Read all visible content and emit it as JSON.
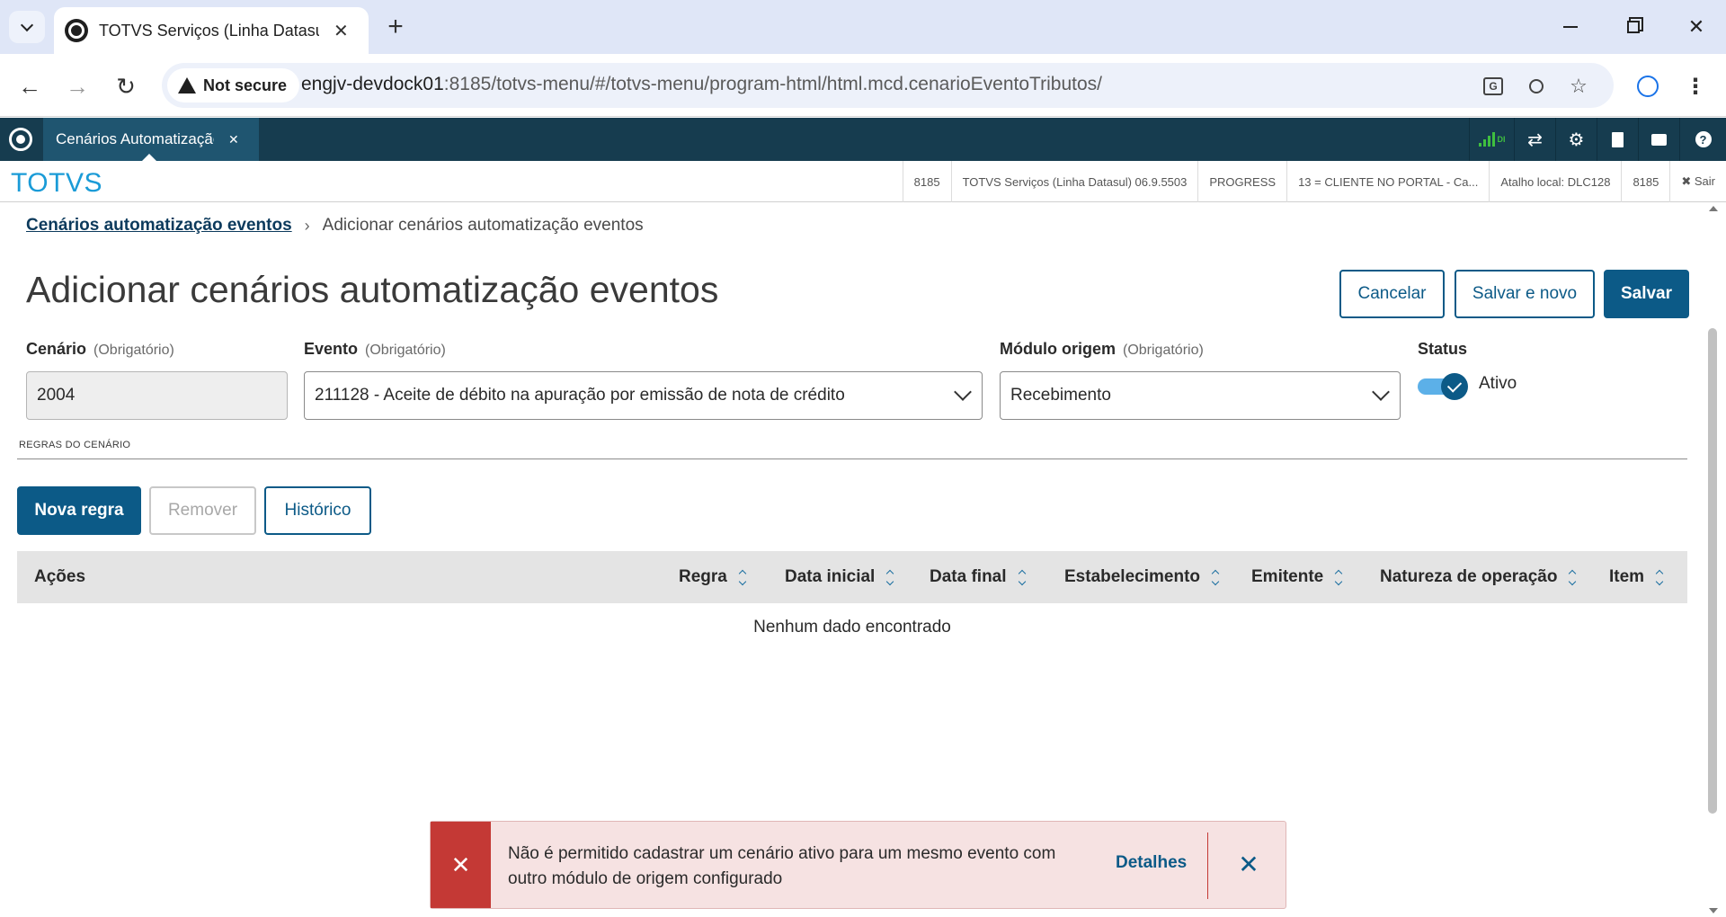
{
  "browser": {
    "tab_title": "TOTVS Serviços (Linha Datasul)",
    "url_host": "engjv-devdock01",
    "url_rest": ":8185/totvs-menu/#/totvs-menu/program-html/html.mcd.cenarioEventoTributos/",
    "security_label": "Not secure",
    "icons": {
      "tab_menu": "chevron-down-icon",
      "close": "close-icon",
      "new_tab": "plus-icon",
      "back": "back-arrow-icon",
      "forward": "forward-arrow-icon",
      "reload": "reload-icon",
      "translate": "translate-icon",
      "zoom": "zoom-out-icon",
      "bookmark": "star-icon",
      "profile": "account-icon",
      "menu": "kebab-menu-icon"
    }
  },
  "app": {
    "tab_title": "Cenários Automatização eventos",
    "brand": "TOTVS",
    "signal_label": "DI",
    "info": [
      "8185",
      "TOTVS Serviços (Linha Datasul) 06.9.5503",
      "PROGRESS",
      "13 = CLIENTE NO PORTAL - Ca...",
      "Atalho local: DLC128",
      "8185"
    ],
    "logout": "✖ Sair"
  },
  "breadcrumb": {
    "parent": "Cenários automatização eventos",
    "current": "Adicionar cenários automatização eventos"
  },
  "page": {
    "title": "Adicionar cenários automatização eventos",
    "actions": {
      "cancel": "Cancelar",
      "save_new": "Salvar e novo",
      "save": "Salvar"
    }
  },
  "form": {
    "cenario": {
      "label": "Cenário",
      "hint": "(Obrigatório)",
      "value": "2004"
    },
    "evento": {
      "label": "Evento",
      "hint": "(Obrigatório)",
      "value": "211128 - Aceite de débito na apuração por emissão de nota de crédito"
    },
    "modulo": {
      "label": "Módulo origem",
      "hint": "(Obrigatório)",
      "value": "Recebimento"
    },
    "status": {
      "label": "Status",
      "value": "Ativo",
      "on": true
    }
  },
  "rules": {
    "section_label": "REGRAS DO CENÁRIO",
    "buttons": {
      "new": "Nova regra",
      "remove": "Remover",
      "history": "Histórico"
    },
    "columns": [
      "Ações",
      "Regra",
      "Data inicial",
      "Data final",
      "Estabelecimento",
      "Emitente",
      "Natureza de operação",
      "Item"
    ],
    "empty": "Nenhum dado encontrado"
  },
  "toast": {
    "message": "Não é permitido cadastrar um cenário ativo para um mesmo evento com outro módulo de origem configurado",
    "action": "Detalhes",
    "type_color": "#c43935"
  }
}
